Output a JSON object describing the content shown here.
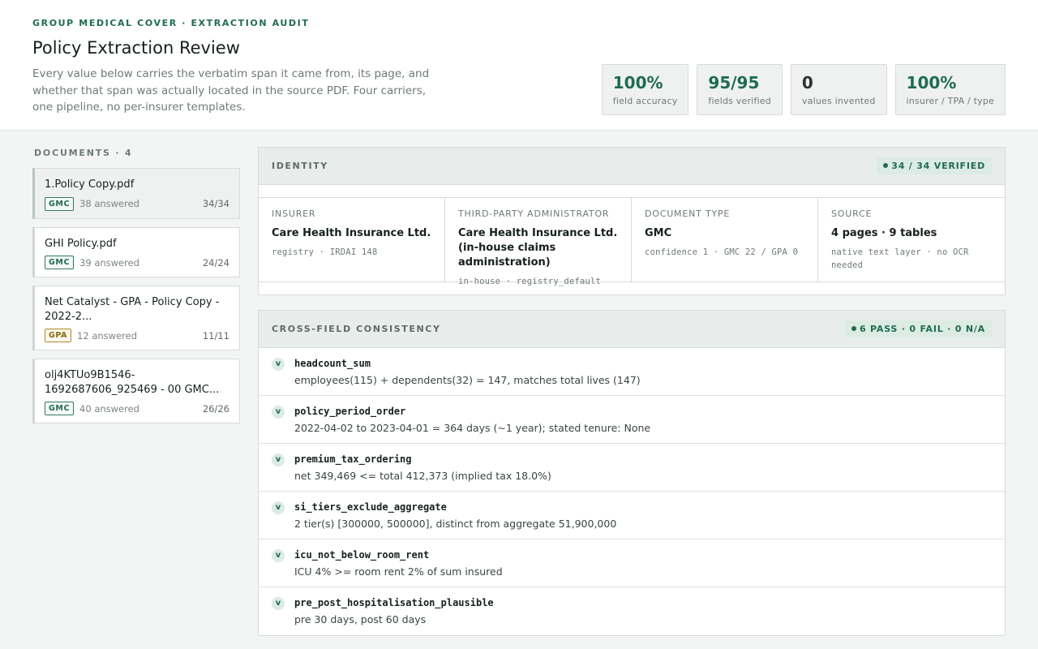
{
  "header": {
    "eyebrow": "GROUP MEDICAL COVER · EXTRACTION AUDIT",
    "title": "Policy Extraction Review",
    "subtitle": "Every value below carries the verbatim span it came from, its page, and whether that span was actually located in the source PDF. Four carriers, one pipeline, no per-insurer templates.",
    "stats": [
      {
        "value": "100%",
        "label": "field accuracy"
      },
      {
        "value": "95/95",
        "label": "fields verified"
      },
      {
        "value": "0",
        "label": "values invented"
      },
      {
        "value": "100%",
        "label": "insurer / TPA / type"
      }
    ]
  },
  "sidebar": {
    "heading": "DOCUMENTS · 4",
    "documents": [
      {
        "name": "1.Policy Copy.pdf",
        "badge": "GMC",
        "answered": "38 answered",
        "count": "34/34"
      },
      {
        "name": "GHI Policy.pdf",
        "badge": "GMC",
        "answered": "39 answered",
        "count": "24/24"
      },
      {
        "name": "Net Catalyst - GPA - Policy Copy - 2022-2...",
        "badge": "GPA",
        "answered": "12 answered",
        "count": "11/11"
      },
      {
        "name": "olj4KTUo9B1546-1692687606_925469 - 00 GMC...",
        "badge": "GMC",
        "answered": "40 answered",
        "count": "26/26"
      }
    ]
  },
  "identity": {
    "title": "IDENTITY",
    "status": "34 / 34 VERIFIED",
    "cells": [
      {
        "label": "INSURER",
        "value": "Care Health Insurance Ltd.",
        "sub": "registry · IRDAI 148"
      },
      {
        "label": "THIRD-PARTY ADMINISTRATOR",
        "value": "Care Health Insurance Ltd. (in-house claims administration)",
        "sub": "in-house · registry_default"
      },
      {
        "label": "DOCUMENT TYPE",
        "value": "GMC",
        "sub": "confidence 1 · GMC 22 / GPA 0"
      },
      {
        "label": "SOURCE",
        "value": "4 pages · 9 tables",
        "sub": "native text layer · no OCR needed"
      }
    ]
  },
  "consistency": {
    "title": "CROSS-FIELD CONSISTENCY",
    "status": "6 PASS · 0 FAIL · 0 N/A",
    "check_glyph": "v",
    "checks": [
      {
        "name": "headcount_sum",
        "desc": "employees(115) + dependents(32) = 147, matches total lives (147)"
      },
      {
        "name": "policy_period_order",
        "desc": "2022-04-02 to 2023-04-01 = 364 days (~1 year); stated tenure: None"
      },
      {
        "name": "premium_tax_ordering",
        "desc": "net 349,469 <= total 412,373 (implied tax 18.0%)"
      },
      {
        "name": "si_tiers_exclude_aggregate",
        "desc": "2 tier(s) [300000, 500000], distinct from aggregate 51,900,000"
      },
      {
        "name": "icu_not_below_room_rent",
        "desc": "ICU 4% >= room rent 2% of sum insured"
      },
      {
        "name": "pre_post_hospitalisation_plausible",
        "desc": "pre 30 days, post 60 days"
      }
    ]
  },
  "colors": {
    "accent": "#1f6b52",
    "gpa_badge": "#8a6a12",
    "panel_head": "#e8edeb"
  }
}
